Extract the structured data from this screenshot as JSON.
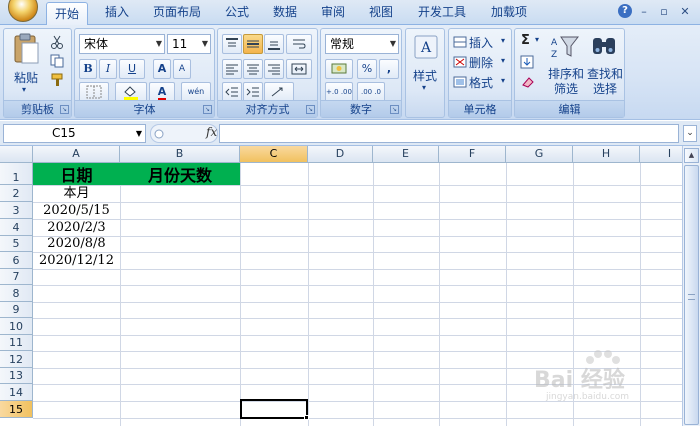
{
  "ribbon_tabs": [
    {
      "label": "开始",
      "active": true
    },
    {
      "label": "插入"
    },
    {
      "label": "页面布局"
    },
    {
      "label": "公式"
    },
    {
      "label": "数据"
    },
    {
      "label": "审阅"
    },
    {
      "label": "视图"
    },
    {
      "label": "开发工具"
    },
    {
      "label": "加载项"
    }
  ],
  "window_controls": {
    "help": "?",
    "minimize": "–",
    "restore": "▫",
    "close": "✕"
  },
  "ribbon": {
    "clipboard": {
      "paste_label": "粘贴",
      "group_label": "剪贴板"
    },
    "font": {
      "font_name": "宋体",
      "font_size": "11",
      "bold": "B",
      "italic": "I",
      "underline": "U",
      "grow": "A",
      "shrink": "A",
      "font_color": "A",
      "phonetic": "wén",
      "group_label": "字体"
    },
    "alignment": {
      "group_label": "对齐方式"
    },
    "number": {
      "format": "常规",
      "percent": "%",
      "comma": ",",
      "inc_decimal": "+.0 .00",
      "dec_decimal": ".00 .0",
      "group_label": "数字"
    },
    "styles": {
      "label": "样式"
    },
    "cells": {
      "insert": "插入",
      "delete": "删除",
      "format": "格式",
      "group_label": "单元格"
    },
    "editing": {
      "sum": "Σ",
      "sort_filter": "排序和\n筛选",
      "find_select": "查找和\n选择",
      "group_label": "编辑"
    }
  },
  "formula_bar": {
    "name_box": "C15",
    "fx": "fx",
    "formula": ""
  },
  "columns": [
    "A",
    "B",
    "C",
    "D",
    "E",
    "F",
    "G",
    "H",
    "I"
  ],
  "rows": [
    "1",
    "2",
    "3",
    "4",
    "5",
    "6",
    "7",
    "8",
    "9",
    "10",
    "11",
    "12",
    "13",
    "14",
    "15"
  ],
  "active_cell": "C15",
  "cells": {
    "A1": "日期",
    "B1": "月份天数",
    "A2": "本月",
    "A3": "2020/5/15",
    "A4": "2020/2/3",
    "A5": "2020/8/8",
    "A6": "2020/12/12"
  },
  "colors": {
    "header_fill": "#00b050",
    "selected_header": "#f1c15f",
    "ribbon_text": "#15428b"
  },
  "watermark": {
    "text": "Bai 经验",
    "sub": "jingyan.baidu.com"
  }
}
